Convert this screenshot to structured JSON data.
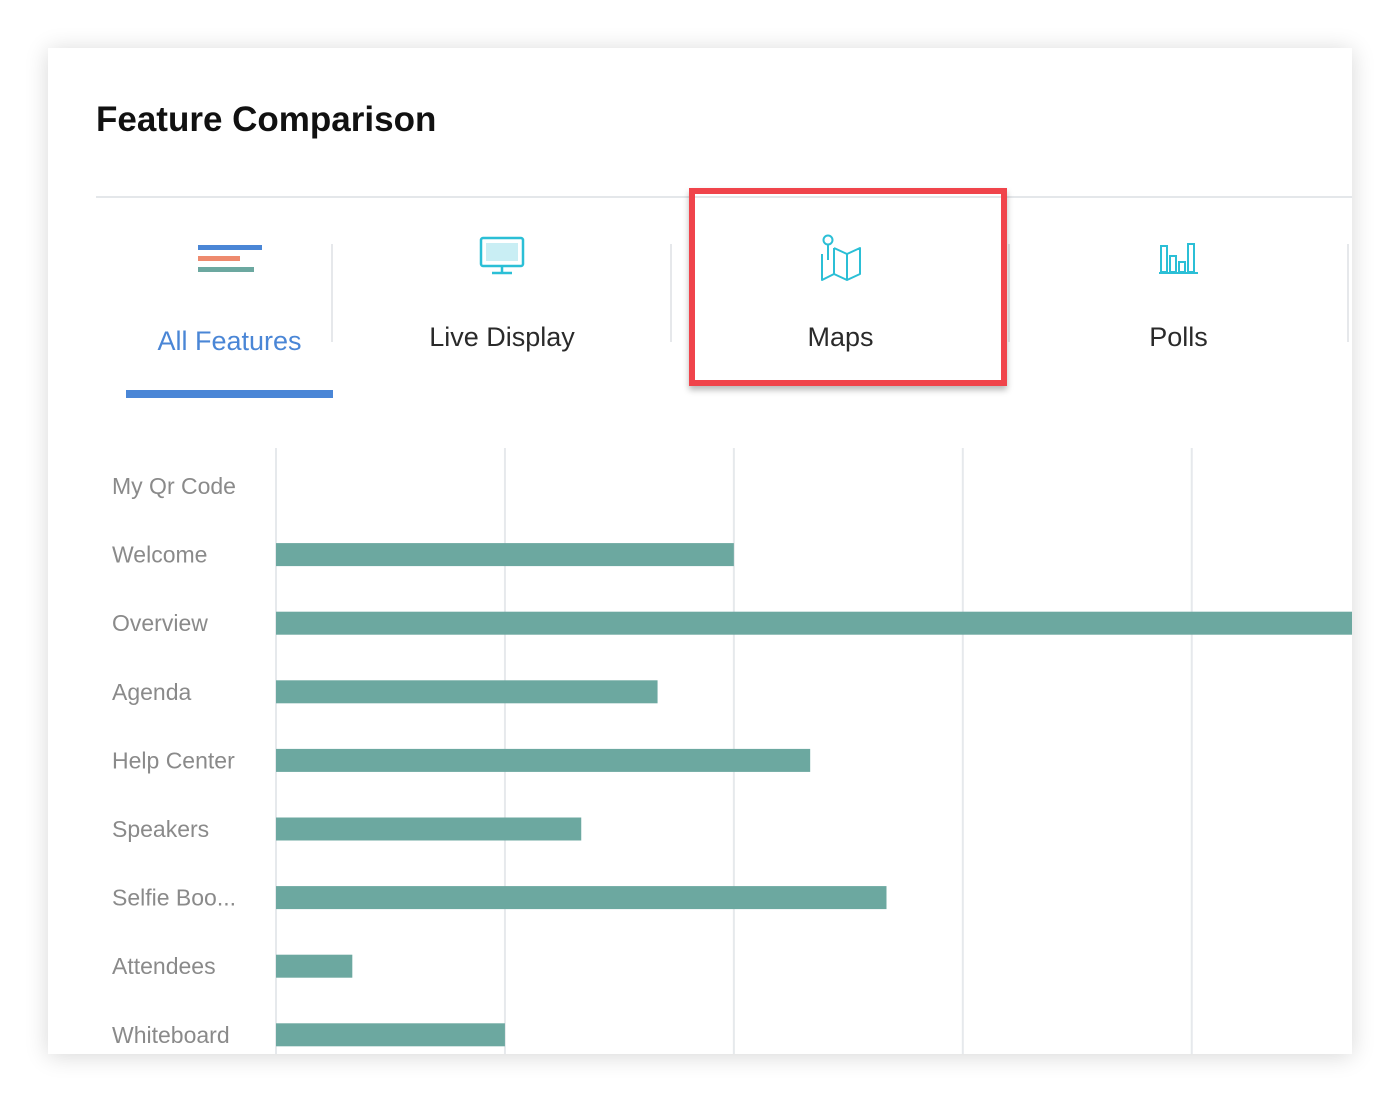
{
  "page": {
    "title": "Feature Comparison"
  },
  "tabs": [
    {
      "label": "All Features",
      "icon": "list-lines-icon",
      "active": true
    },
    {
      "label": "Live Display",
      "icon": "monitor-icon",
      "active": false
    },
    {
      "label": "Maps",
      "icon": "map-pin-icon",
      "active": false
    },
    {
      "label": "Polls",
      "icon": "bar-chart-icon",
      "active": false
    }
  ],
  "colors": {
    "accent": "#4a86d6",
    "bar": "#6ca8a0",
    "highlight": "#f0444b",
    "icon_teal": "#2bbfd6",
    "grid": "#e6e9ec",
    "label": "#8a8a8a"
  },
  "chart_data": {
    "type": "bar",
    "orientation": "horizontal",
    "categories": [
      "My Qr Code",
      "Welcome",
      "Overview",
      "Agenda",
      "Help Center",
      "Speakers",
      "Selfie Boo...",
      "Attendees",
      "Whiteboard"
    ],
    "values": [
      0,
      6,
      14.1,
      5,
      7,
      4,
      8,
      1,
      3
    ],
    "xlim": [
      0,
      14.1
    ],
    "grid": true,
    "legend": "none"
  }
}
